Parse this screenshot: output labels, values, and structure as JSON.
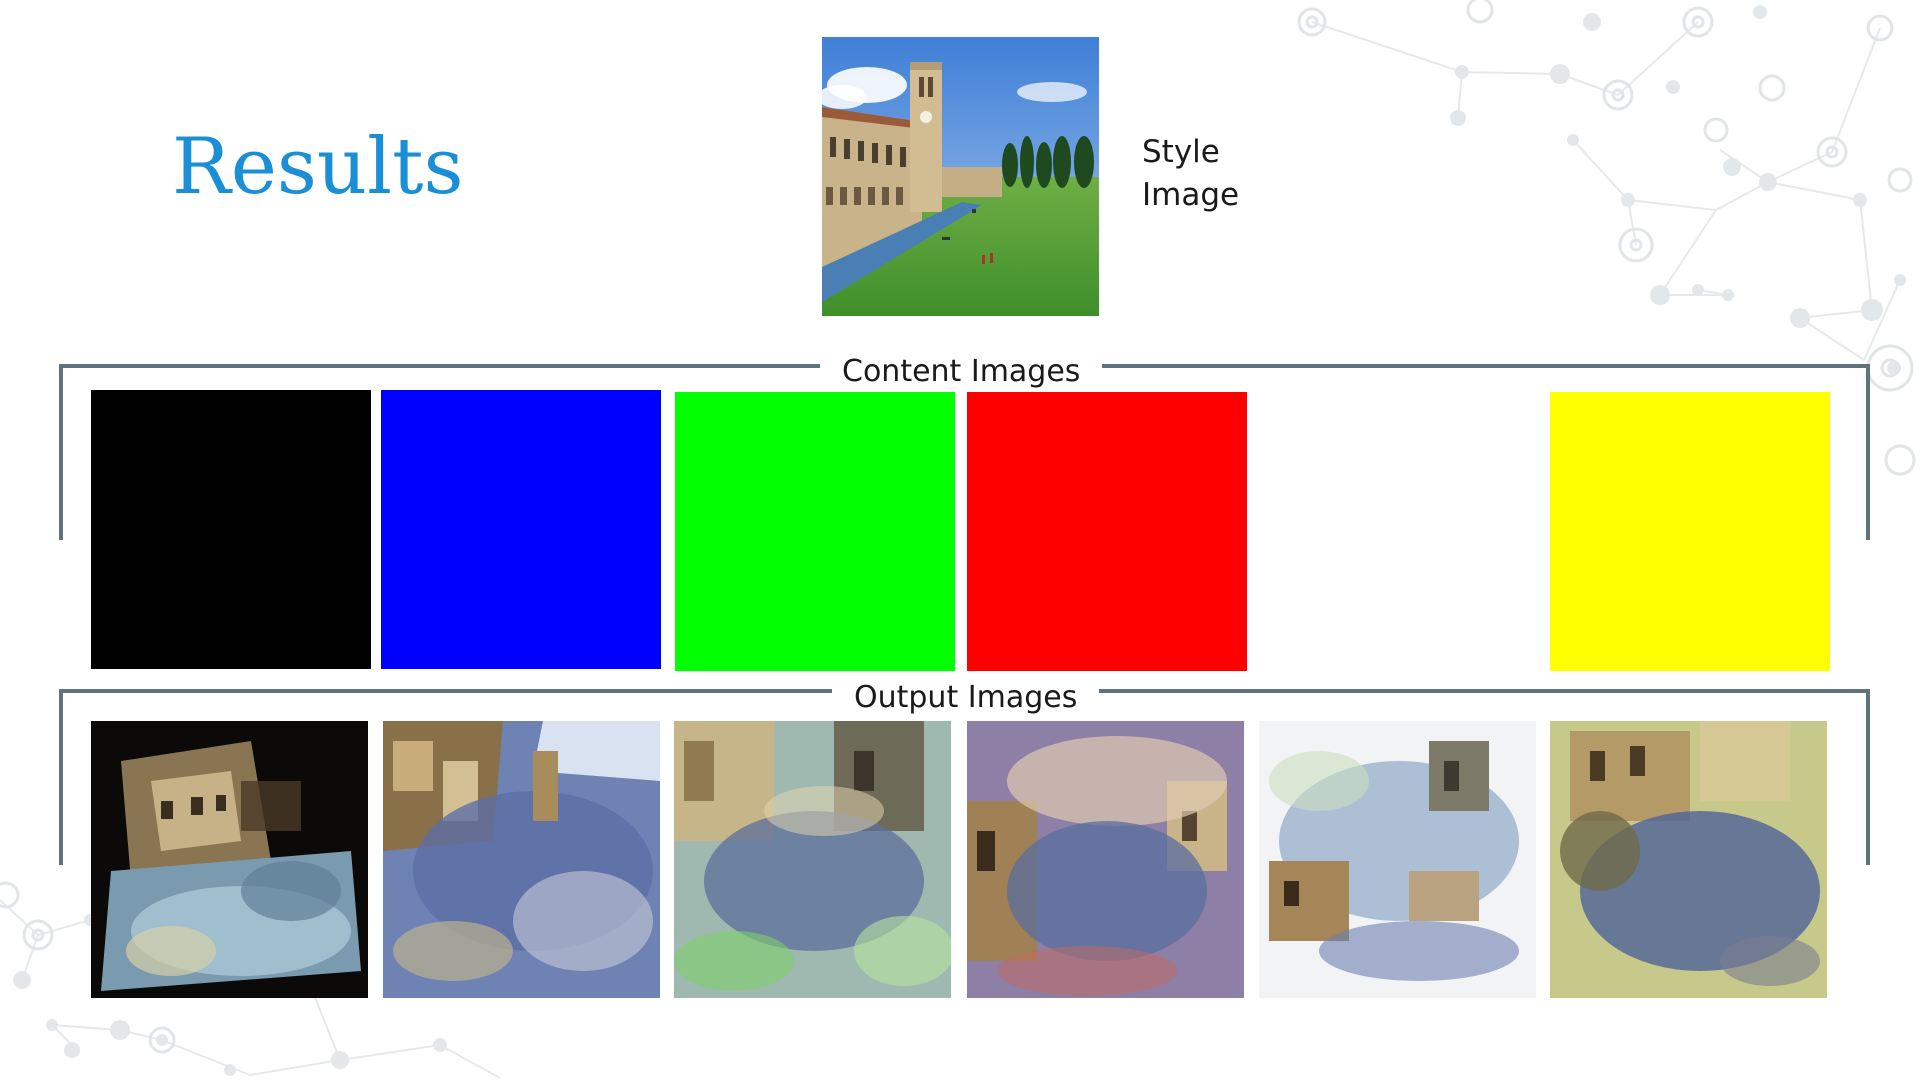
{
  "slide": {
    "title": "Results",
    "style_label_line1": "Style",
    "style_label_line2": "Image",
    "content_label": "Content Images",
    "output_label": "Output Images"
  },
  "colors": {
    "title": "#1b8fd6",
    "bracket": "#5f737e",
    "content_images": [
      "#000000",
      "#0000ff",
      "#00ff00",
      "#ff0000",
      "#ffffff",
      "#ffff00"
    ]
  }
}
